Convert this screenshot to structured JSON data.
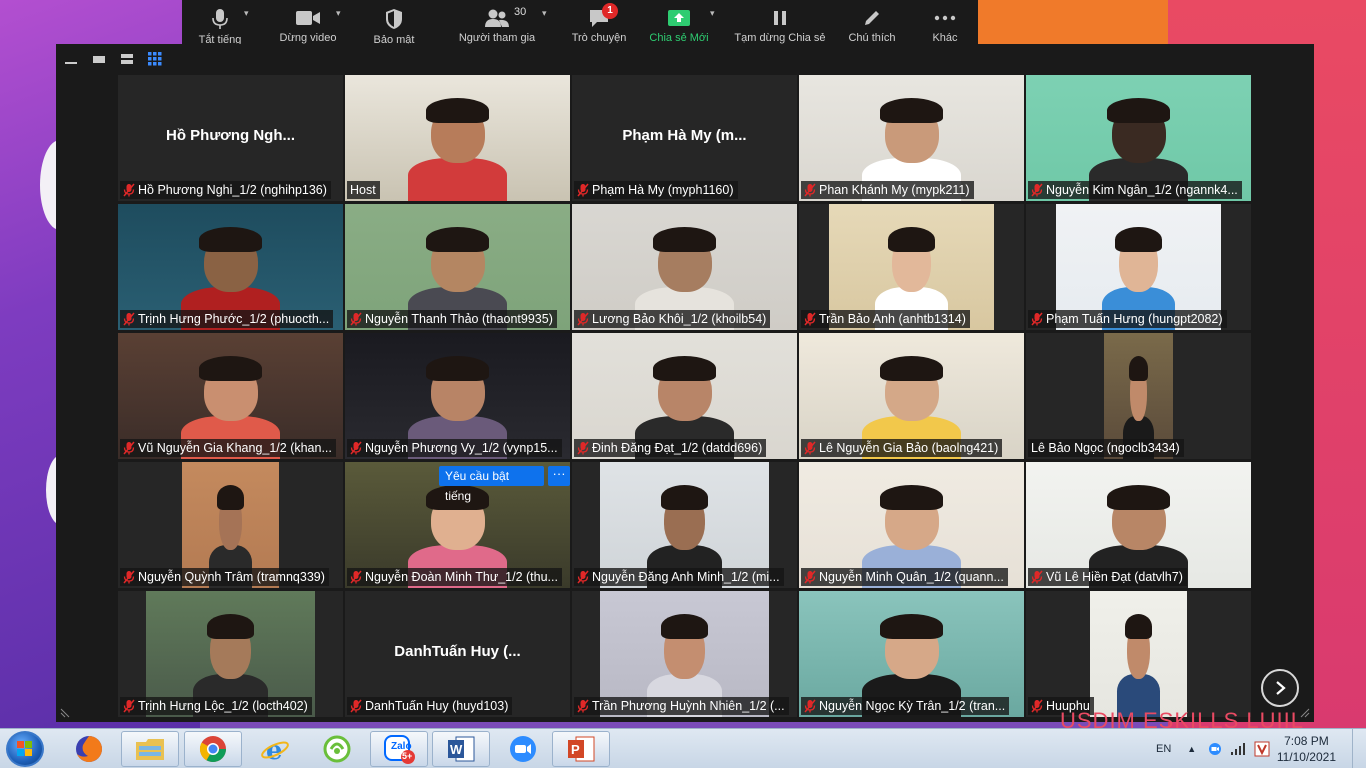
{
  "toolbar": {
    "items": [
      {
        "label": "Tắt tiếng",
        "icon": "microphone-icon"
      },
      {
        "label": "Dừng video",
        "icon": "video-camera-icon"
      },
      {
        "label": "Bảo mật",
        "icon": "shield-icon"
      },
      {
        "label": "Người tham gia",
        "icon": "participants-icon",
        "count": "30"
      },
      {
        "label": "Trò chuyện",
        "icon": "chat-icon",
        "badge": "1"
      },
      {
        "label": "Chia sẻ Mới",
        "icon": "share-screen-icon"
      },
      {
        "label": "Tạm dừng Chia sẻ",
        "icon": "pause-icon"
      },
      {
        "label": "Chú thích",
        "icon": "pencil-icon"
      },
      {
        "label": "Khác",
        "icon": "more-icon"
      }
    ],
    "share_color": "#2ecc71"
  },
  "participants": [
    {
      "name": "Hồ Phương Nghi_1/2 (nghihp136)",
      "placeholder": "Hồ Phương Ngh...",
      "muted": true
    },
    {
      "name": "Host",
      "muted": false
    },
    {
      "name": "Phạm Hà My (myph1160)",
      "placeholder": "Phạm Hà My (m...",
      "muted": true
    },
    {
      "name": "Phan Khánh My (mypk211)",
      "muted": true
    },
    {
      "name": "Nguyễn Kim Ngân_1/2 (ngannk4...",
      "muted": true
    },
    {
      "name": "Trịnh Hưng Phước_1/2 (phuocth...",
      "muted": true
    },
    {
      "name": "Nguyễn Thanh Thảo (thaont9935)",
      "muted": true
    },
    {
      "name": "Lương Bảo Khôi_1/2 (khoilb54)",
      "muted": true
    },
    {
      "name": "Trần Bảo Anh (anhtb1314)",
      "muted": true
    },
    {
      "name": "Phạm Tuấn Hưng (hungpt2082)",
      "muted": true
    },
    {
      "name": "Vũ Nguyễn Gia Khang_1/2 (khan...",
      "muted": true
    },
    {
      "name": "Nguyễn Phương Vy_1/2 (vynp15...",
      "muted": true
    },
    {
      "name": "Đinh Đăng Đạt_1/2 (datdd696)",
      "muted": true
    },
    {
      "name": "Lê Nguyễn Gia Bảo (baolng421)",
      "muted": true
    },
    {
      "name": "Lê Bảo Ngọc (ngoclb3434)",
      "muted": false
    },
    {
      "name": "Nguyễn Quỳnh Trâm (tramnq339)",
      "muted": true
    },
    {
      "name": "Nguyễn Đoàn Minh Thư_1/2 (thu...",
      "muted": true,
      "active": true
    },
    {
      "name": "Nguyễn Đăng Anh Minh_1/2 (mi...",
      "muted": true
    },
    {
      "name": "Nguyễn Minh Quân_1/2 (quann...",
      "muted": true
    },
    {
      "name": "Vũ Lê Hiền Đạt (datvlh7)",
      "muted": true
    },
    {
      "name": "Trịnh Hưng Lộc_1/2 (locth402)",
      "muted": true
    },
    {
      "name": "DanhTuấn Huy (huyd103)",
      "placeholder": "DanhTuấn Huy (...",
      "muted": true
    },
    {
      "name": "Trần Phương Huỳnh Nhiên_1/2 (...",
      "muted": true
    },
    {
      "name": "Nguyễn Ngọc Kỳ Trân_1/2 (tran...",
      "muted": true
    },
    {
      "name": "Huuphu",
      "muted": true
    }
  ],
  "request_unmute": {
    "label": "Yêu cầu bật tiếng",
    "more": "···"
  },
  "taskbar": {
    "apps": [
      "firefox-icon",
      "file-explorer-icon",
      "chrome-icon",
      "internet-explorer-icon",
      "coc-coc-icon",
      "zalo-icon",
      "word-icon",
      "zoom-icon",
      "powerpoint-icon"
    ],
    "zalo_label": "Zalo",
    "zalo_badge": "5+",
    "language": "EN",
    "time": "7:08 PM",
    "date": "11/10/2021"
  },
  "background_text": "USDIM ESKILLS LUIIL"
}
